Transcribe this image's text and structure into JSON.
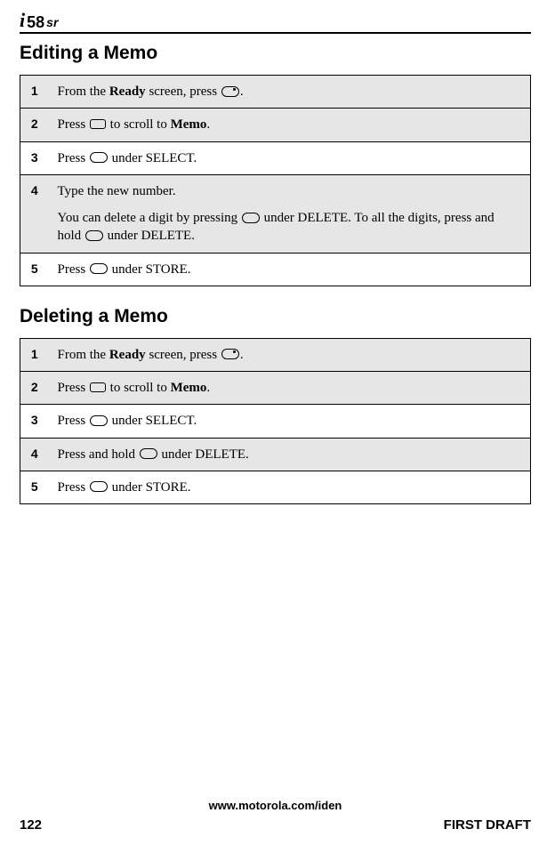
{
  "header": {
    "logo_i": "i",
    "logo_num": "58",
    "logo_suffix": "sr"
  },
  "sections": {
    "editing": {
      "title": "Editing a Memo",
      "steps": {
        "s1": {
          "num": "1",
          "pre": "From the ",
          "bold": "Ready",
          "post": " screen, press ",
          "tail": "."
        },
        "s2": {
          "num": "2",
          "pre": "Press ",
          "mid": " to scroll to ",
          "bold": "Memo",
          "tail": "."
        },
        "s3": {
          "num": "3",
          "pre": "Press ",
          "tail": " under SELECT."
        },
        "s4": {
          "num": "4",
          "line1": "Type the new number.",
          "line2a": "You can delete a digit by pressing ",
          "line2b": " under DELETE. To all the digits, press and hold ",
          "line2c": " under DELETE."
        },
        "s5": {
          "num": "5",
          "pre": "Press ",
          "tail": " under STORE."
        }
      }
    },
    "deleting": {
      "title": "Deleting a Memo",
      "steps": {
        "s1": {
          "num": "1",
          "pre": "From the ",
          "bold": "Ready",
          "post": " screen, press ",
          "tail": "."
        },
        "s2": {
          "num": "2",
          "pre": "Press ",
          "mid": " to scroll to ",
          "bold": "Memo",
          "tail": "."
        },
        "s3": {
          "num": "3",
          "pre": "Press ",
          "tail": " under SELECT."
        },
        "s4": {
          "num": "4",
          "pre": "Press and hold ",
          "tail": " under DELETE."
        },
        "s5": {
          "num": "5",
          "pre": "Press ",
          "tail": " under STORE."
        }
      }
    }
  },
  "footer": {
    "url": "www.motorola.com/iden",
    "page": "122",
    "draft": "FIRST DRAFT"
  }
}
